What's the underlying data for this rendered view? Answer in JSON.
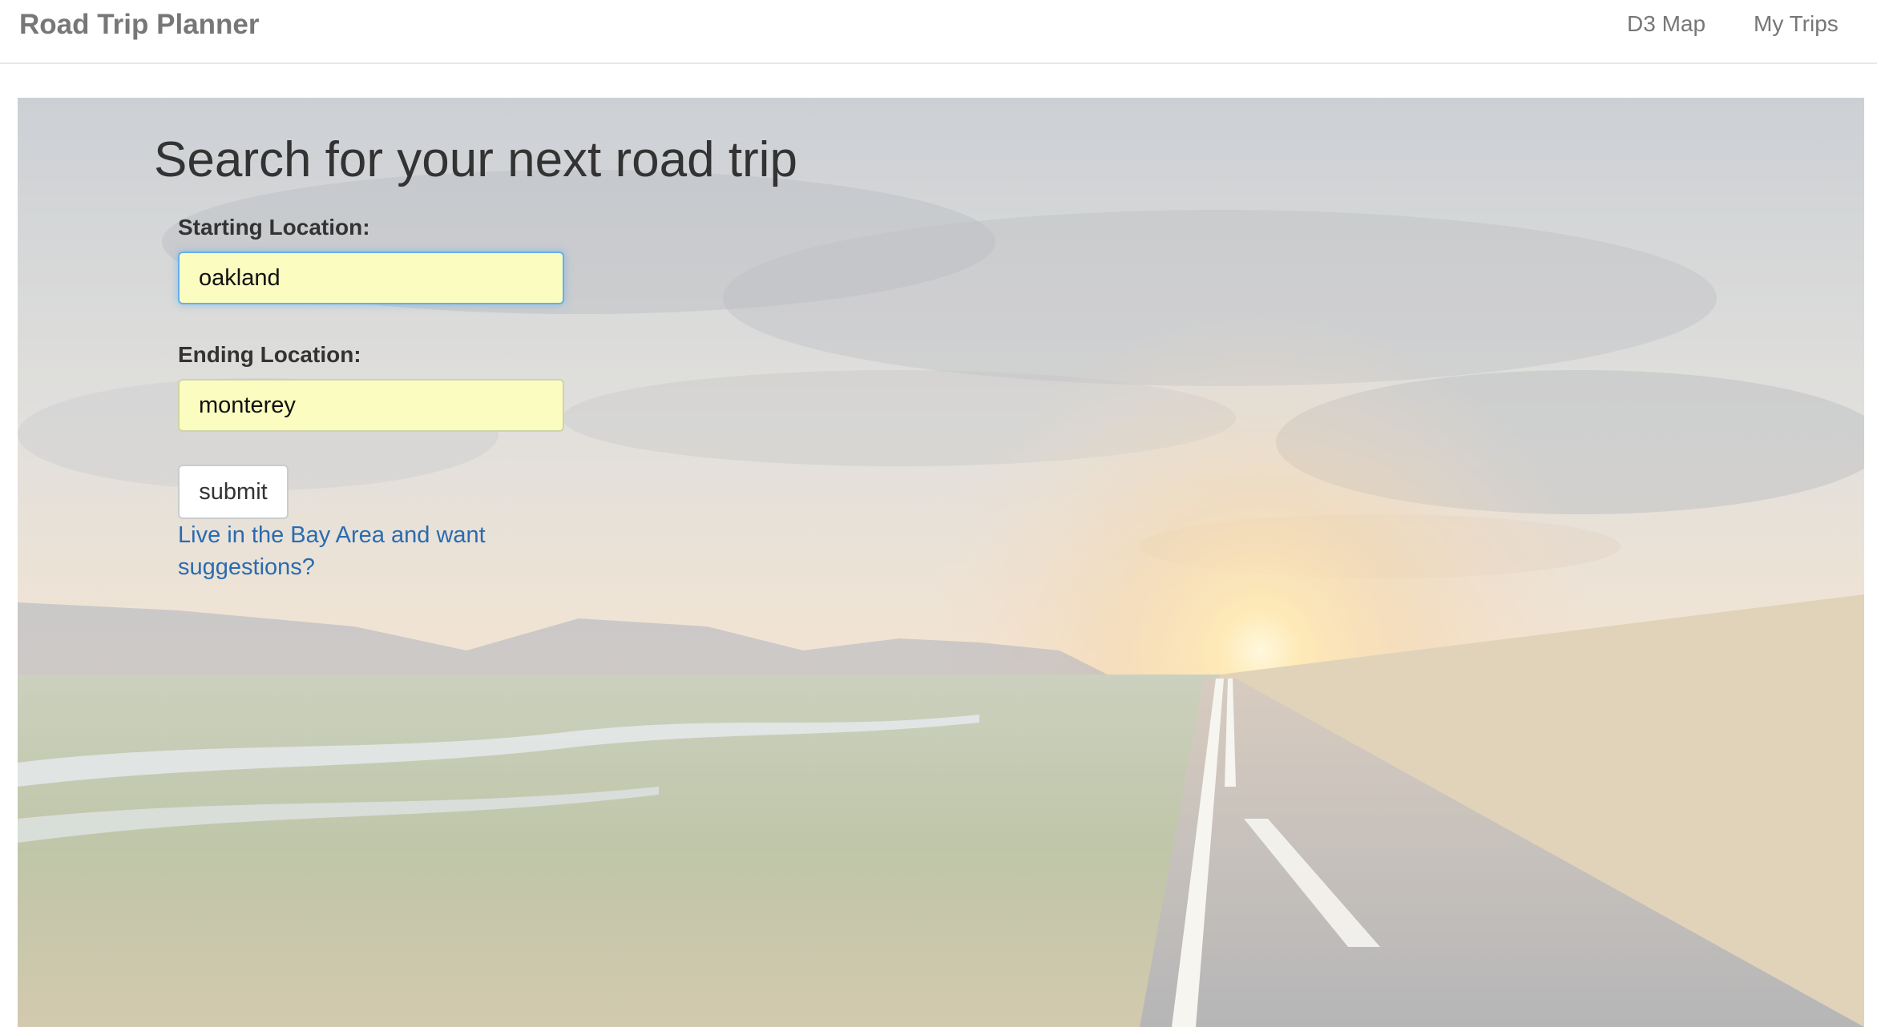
{
  "navbar": {
    "brand": "Road Trip Planner",
    "links": [
      {
        "label": "D3 Map"
      },
      {
        "label": "My Trips"
      }
    ]
  },
  "hero": {
    "heading": "Search for your next road trip",
    "start": {
      "label": "Starting Location:",
      "value": "oakland"
    },
    "end": {
      "label": "Ending Location:",
      "value": "monterey"
    },
    "submit_label": "submit",
    "suggestion_link": "Live in the Bay Area and want suggestions?"
  },
  "colors": {
    "input_bg": "#fafcc0",
    "link": "#2a6bb0",
    "focus_border": "#66afe9"
  }
}
